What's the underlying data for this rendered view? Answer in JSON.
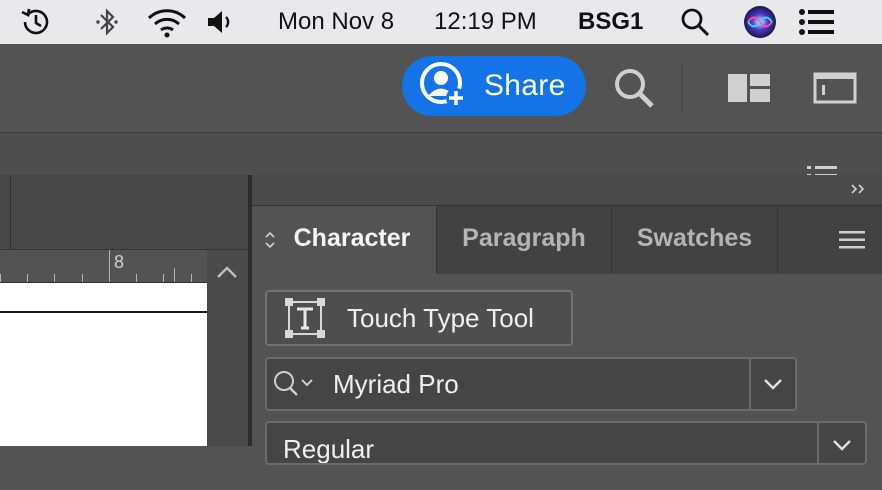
{
  "menubar": {
    "date": "Mon Nov 8",
    "time": "12:19 PM",
    "user": "BSG1",
    "icons": [
      "time-machine-icon",
      "bluetooth-icon",
      "wifi-icon",
      "volume-icon",
      "spotlight-search-icon",
      "siri-icon",
      "control-center-icon"
    ]
  },
  "appbar": {
    "share_label": "Share",
    "icons": [
      "search-icon",
      "workspace-layout-icon",
      "panel-toggle-icon"
    ]
  },
  "ruler": {
    "label": "8"
  },
  "panel": {
    "tabs": [
      {
        "label": "Character",
        "active": true
      },
      {
        "label": "Paragraph",
        "active": false
      },
      {
        "label": "Swatches",
        "active": false
      }
    ],
    "touch_type_label": "Touch Type Tool",
    "font_family": "Myriad Pro",
    "font_style": "Regular"
  },
  "colors": {
    "accent": "#1473e6",
    "panel_bg": "#535353",
    "menubar_bg": "#e9e9ec"
  }
}
